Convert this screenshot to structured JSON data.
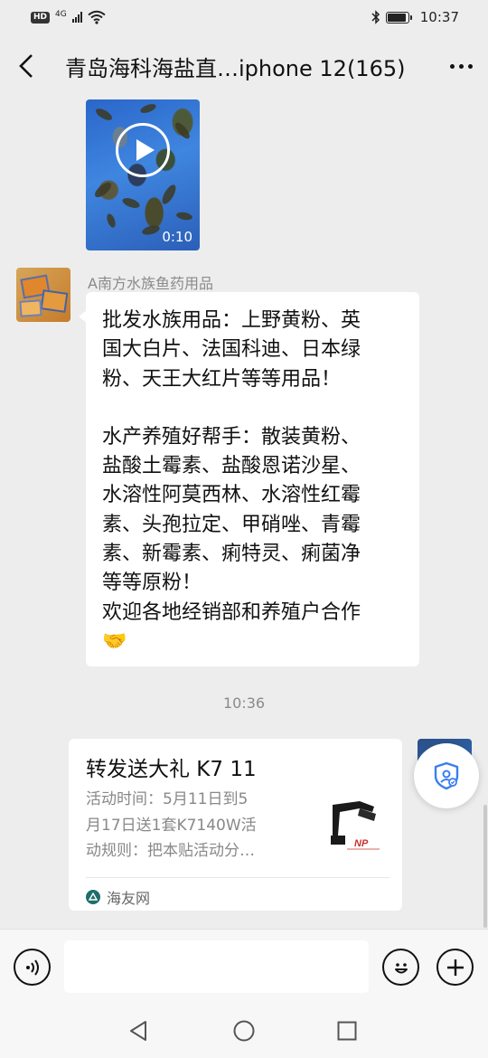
{
  "status_bar": {
    "hd": "HD",
    "network": "4G",
    "time": "10:37"
  },
  "nav": {
    "title": "青岛海科海盐直…iphone 12(165)"
  },
  "messages": {
    "video": {
      "duration": "0:10"
    },
    "text_message": {
      "sender": "A南方水族鱼药用品",
      "lines_para1": [
        "批发水族用品：上野黄粉、英",
        "国大白片、法国科迪、日本绿",
        "粉、天王大红片等等用品！"
      ],
      "lines_para2": [
        "水产养殖好帮手：散装黄粉、",
        "盐酸土霉素、盐酸恩诺沙星、",
        "水溶性阿莫西林、水溶性红霉",
        "素、头孢拉定、甲硝唑、青霉",
        "素、新霉素、痢特灵、痢菌净",
        "等等原粉！",
        "欢迎各地经销部和养殖户合作"
      ],
      "emoji": "🤝"
    },
    "timestamp": "10:36",
    "link_card": {
      "title": "转发送大礼 K7 11",
      "desc_lines": [
        "活动时间：5月11日到5",
        "月17日送1套K7140W活",
        "动规则：把本贴活动分…"
      ],
      "source": "海友网",
      "thumb_label": "NP"
    }
  },
  "input": {
    "placeholder": ""
  }
}
